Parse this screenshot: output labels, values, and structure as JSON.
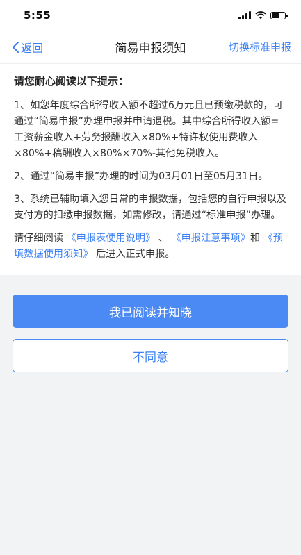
{
  "status_bar": {
    "time": "5:55"
  },
  "nav": {
    "back_label": "返回",
    "title": "简易申报须知",
    "right_label": "切换标准申报"
  },
  "content": {
    "heading": "请您耐心阅读以下提示：",
    "para1": "1、如您年度综合所得收入额不超过6万元且已预缴税款的，可通过“简易申报”办理申报并申请退税。其中综合所得收入额=工资薪金收入+劳务报酬收入×80%+特许权使用费收入×80%+稿酬收入×80%×70%-其他免税收入。",
    "para2": "2、通过“简易申报”办理的时间为03月01日至05月31日。",
    "para3": "3、系统已辅助填入您日常的申报数据，包括您的自行申报以及支付方的扣缴申报数据，如需修改，请通过“标准申报”办理。",
    "para4_prefix": "请仔细阅读 ",
    "link1": "《申报表使用说明》",
    "sep1": " 、 ",
    "link2": "《申报注意事项》",
    "sep2": "和 ",
    "link3": "《预填数据使用须知》",
    "para4_suffix": " 后进入正式申报。"
  },
  "actions": {
    "agree_label": "我已阅读并知晓",
    "disagree_label": "不同意"
  },
  "colors": {
    "accent": "#3a7ff6",
    "primary_button": "#4b8af5",
    "background": "#f2f3f5"
  }
}
